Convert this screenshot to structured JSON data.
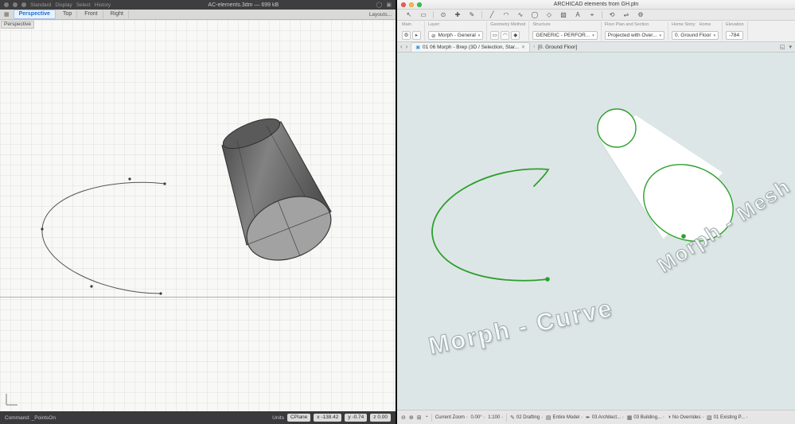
{
  "colors": {
    "mac_close": "#fc5753",
    "mac_minimize": "#fdbc40",
    "mac_zoom": "#33c748",
    "archicad_green": "#2ca02c",
    "rhino_active_tab_blue": "#1f6fd0",
    "left_canvas_bg": "#f8f8f6",
    "right_canvas_bg": "#dde6e6"
  },
  "ui": {
    "chevron_down": "▾",
    "chevron_right": "›"
  },
  "left_window": {
    "titlebar": {
      "title": "AC-elements.3dm — 699 kB",
      "menu_items": [
        "Standard",
        "Display",
        "Select",
        "History"
      ],
      "right_icons": [
        {
          "name": "gallery-icon",
          "glyph": "◯"
        },
        {
          "name": "panels-icon",
          "glyph": "▣"
        }
      ]
    },
    "viewport_tabs": {
      "grid_icon": "▦",
      "tabs": [
        "Perspective",
        "Top",
        "Front",
        "Right"
      ],
      "active_tab": "Perspective",
      "layouts_label": "Layouts..."
    },
    "viewport": {
      "label": "Perspective"
    },
    "command_bar": {
      "prompt": "Command: _PointsOn",
      "units_label": "Units",
      "cplane_label": "CPlane",
      "x_value": "x -138.42",
      "y_value": "y -0.74",
      "z_value": "z 0.00"
    }
  },
  "right_window": {
    "titlebar": {
      "title": "ARCHICAD elements from GH.pln"
    },
    "toolbar": {
      "icons": [
        {
          "name": "arrow-tool-icon",
          "glyph": "↖"
        },
        {
          "name": "marquee-tool-icon",
          "glyph": "▭"
        },
        {
          "name": "zoom-tool-icon",
          "glyph": "⊙"
        },
        {
          "name": "pan-tool-icon",
          "glyph": "✚"
        },
        {
          "name": "pencil-tool-icon",
          "glyph": "✎"
        },
        {
          "name": "line-tool-icon",
          "glyph": "╱"
        },
        {
          "name": "arc-tool-icon",
          "glyph": "◠"
        },
        {
          "name": "spline-tool-icon",
          "glyph": "∿"
        },
        {
          "name": "circle-tool-icon",
          "glyph": "◯"
        },
        {
          "name": "polygon-tool-icon",
          "glyph": "◇"
        },
        {
          "name": "hatch-tool-icon",
          "glyph": "▨"
        },
        {
          "name": "text-tool-icon",
          "glyph": "A"
        },
        {
          "name": "dimension-tool-icon",
          "glyph": "⌖"
        },
        {
          "name": "rotate-tool-icon",
          "glyph": "⟲"
        },
        {
          "name": "mirror-tool-icon",
          "glyph": "⇌"
        },
        {
          "name": "settings-icon",
          "glyph": "⚙"
        }
      ]
    },
    "info_bar": {
      "main_label": "Main",
      "main_gear_icon": "⚙",
      "main_more_icon": "▸",
      "layer_label": "Layer:",
      "layer_icon": "⊘",
      "layer_value": "Morph - General",
      "geometry_label": "Geometry Method",
      "geometry_icons": [
        "▭",
        "◠",
        "◆"
      ],
      "structure_label": "Structure",
      "structure_value": "GENERIC - PERFOR...",
      "floorplan_label": "Floor Plan and Section",
      "floorplan_value": "Projected with Over...",
      "homestory_label": "Home Story:",
      "homestory_home": "Home",
      "homestory_value": "0. Ground Floor",
      "elevation_label": "Elevation",
      "elevation_value": "-784"
    },
    "tab_bar": {
      "back_icon": "‹",
      "forward_icon": "›",
      "tab_icon": "▣",
      "tab_title": "01 06 Morph - Brep (3D / Selection, Star...",
      "close_icon": "✕",
      "breadcrumb": "[0. Ground Floor]",
      "right_icons": [
        {
          "name": "expand-icon",
          "glyph": "◱"
        },
        {
          "name": "more-icon",
          "glyph": "▾"
        }
      ]
    },
    "canvas": {
      "watermark_curve": "Morph - Curve",
      "watermark_mesh": "Morph - Mesh"
    },
    "status_bar": {
      "zoom_out_icon": "⊖",
      "zoom_in_icon": "⊕",
      "fit_icon": "⊞",
      "orbit_icon": "◔",
      "zoom_label": "Current Zoom",
      "rotation_value": "0.00°",
      "scale_value": "1:100",
      "items": [
        {
          "icon": "✎",
          "label": "02 Drafting"
        },
        {
          "icon": "▤",
          "label": "Entire Model"
        },
        {
          "icon": "✒",
          "label": "03 Architect..."
        },
        {
          "icon": "▦",
          "label": "03 Building..."
        },
        {
          "icon": "◑",
          "label": "No Overrides"
        },
        {
          "icon": "▧",
          "label": "01 Existing P..."
        }
      ]
    }
  }
}
